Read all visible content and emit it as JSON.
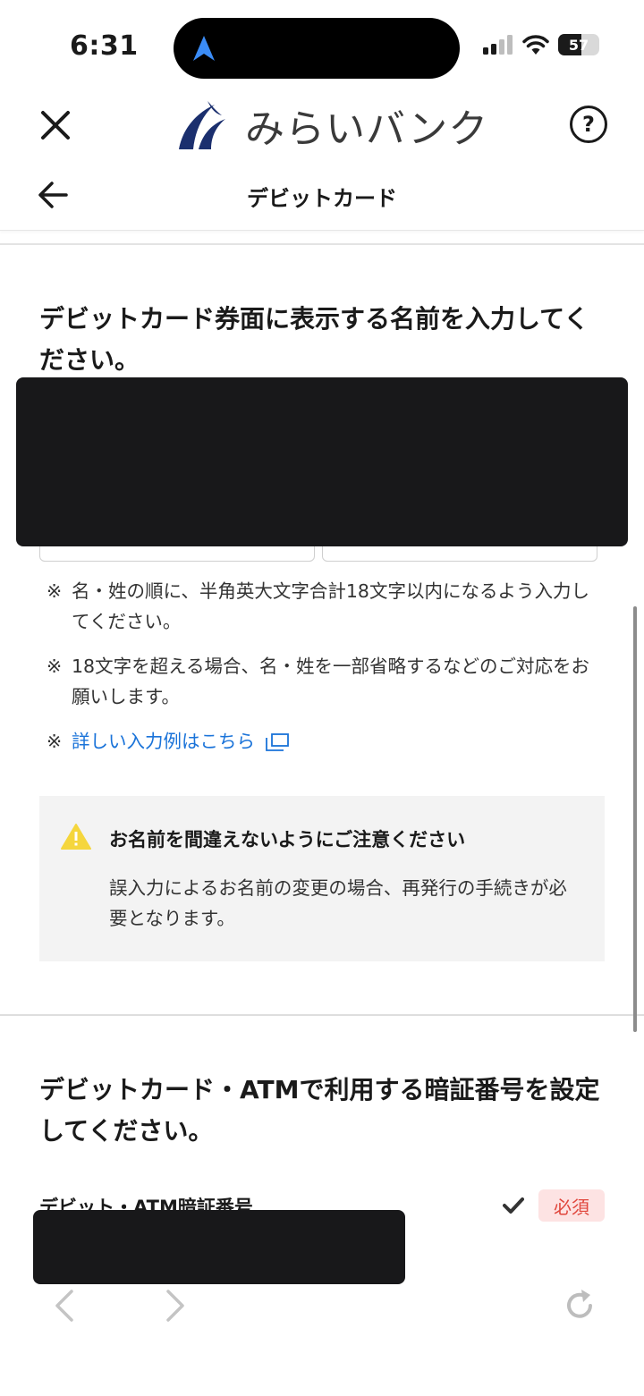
{
  "status_bar": {
    "time": "6:31",
    "battery": "57"
  },
  "app_bar": {
    "logo_text": "みらいバンク",
    "help_label": "?"
  },
  "sub_header": {
    "title": "デビットカード"
  },
  "name_section": {
    "title": "デビットカード券面に表示する名前を入力してください。",
    "first_name_value": "",
    "last_name_value": "",
    "notes": [
      {
        "mark": "※",
        "text": "名・姓の順に、半角英大文字合計18文字以内になるよう入力してください。"
      },
      {
        "mark": "※",
        "text": "18文字を超える場合、名・姓を一部省略するなどのご対応をお願いします。"
      }
    ],
    "link": {
      "mark": "※",
      "text": "詳しい入力例はこちら"
    },
    "warning": {
      "title": "お名前を間違えないようにご注意ください",
      "body": "誤入力によるお名前の変更の場合、再発行の手続きが必要となります。"
    }
  },
  "pin_section": {
    "title": "デビットカード・ATMで利用する暗証番号を設定してください。",
    "field_label": "デビット・ATM暗証番号",
    "required_badge": "必須"
  },
  "colors": {
    "link": "#1a73d9",
    "required_bg": "#fde3e3",
    "required_text": "#e0463c",
    "warning_icon": "#f5d63d",
    "logo_navy": "#1b2f6e"
  },
  "icons": [
    "close-icon",
    "help-icon",
    "back-arrow-icon",
    "external-link-icon",
    "warning-icon",
    "check-icon",
    "browser-back-icon",
    "browser-forward-icon",
    "reload-icon"
  ]
}
